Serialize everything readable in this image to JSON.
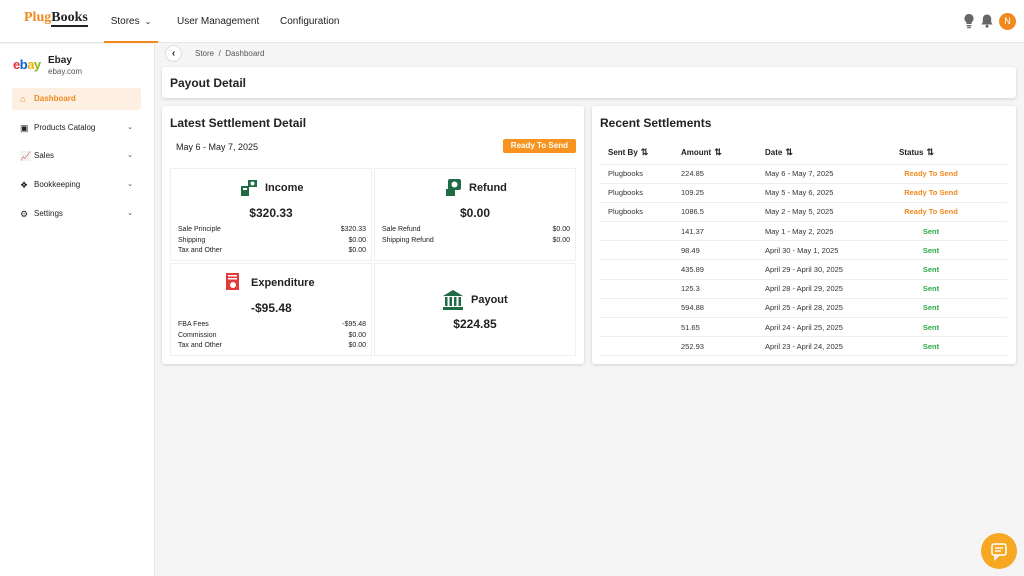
{
  "header": {
    "logo_part1": "Plug",
    "logo_part2": "Books",
    "nav": {
      "stores": "Stores",
      "user_management": "User Management",
      "configuration": "Configuration"
    },
    "avatar_initial": "N",
    "icons": [
      "lightbulb-icon",
      "bell-icon"
    ]
  },
  "sidebar": {
    "store_logo": {
      "e": "e",
      "b": "b",
      "a": "a",
      "y": "y"
    },
    "store_name": "Ebay",
    "store_domain": "ebay.com",
    "items": [
      {
        "label": "Dashboard",
        "icon": "home-icon",
        "active": true
      },
      {
        "label": "Products Catalog",
        "icon": "box-icon"
      },
      {
        "label": "Sales",
        "icon": "chart-icon"
      },
      {
        "label": "Bookkeeping",
        "icon": "book-icon"
      },
      {
        "label": "Settings",
        "icon": "gear-icon"
      }
    ]
  },
  "breadcrumb": {
    "store": "Store",
    "sep": "/",
    "page": "Dashboard"
  },
  "page_title": "Payout Detail",
  "latest": {
    "title": "Latest Settlement Detail",
    "range": "May 6 - May 7, 2025",
    "badge": "Ready To Send",
    "income": {
      "title": "Income",
      "amount": "$320.33",
      "rows": [
        {
          "label": "Sale Principle",
          "value": "$320.33"
        },
        {
          "label": "Shipping",
          "value": "$0.00"
        },
        {
          "label": "Tax and Other",
          "value": "$0.00"
        }
      ]
    },
    "refund": {
      "title": "Refund",
      "amount": "$0.00",
      "rows": [
        {
          "label": "Sale Refund",
          "value": "$0.00"
        },
        {
          "label": "Shipping Refund",
          "value": "$0.00"
        }
      ]
    },
    "expenditure": {
      "title": "Expenditure",
      "amount": "-$95.48",
      "rows": [
        {
          "label": "FBA Fees",
          "value": "-$95.48"
        },
        {
          "label": "Commission",
          "value": "$0.00"
        },
        {
          "label": "Tax and Other",
          "value": "$0.00"
        }
      ]
    },
    "payout": {
      "title": "Payout",
      "amount": "$224.85"
    }
  },
  "recent": {
    "title": "Recent Settlements",
    "columns": [
      "Sent By",
      "Amount",
      "Date",
      "Status"
    ],
    "rows": [
      {
        "sent_by": "Plugbooks",
        "amount": "224.85",
        "date": "May 6 - May 7, 2025",
        "status": "Ready To Send"
      },
      {
        "sent_by": "Plugbooks",
        "amount": "109.25",
        "date": "May 5 - May 6, 2025",
        "status": "Ready To Send"
      },
      {
        "sent_by": "Plugbooks",
        "amount": "1086.5",
        "date": "May 2 - May 5, 2025",
        "status": "Ready To Send"
      },
      {
        "sent_by": "",
        "amount": "141.37",
        "date": "May 1 - May 2, 2025",
        "status": "Sent"
      },
      {
        "sent_by": "",
        "amount": "98.49",
        "date": "April 30 - May 1, 2025",
        "status": "Sent"
      },
      {
        "sent_by": "",
        "amount": "435.89",
        "date": "April 29 - April 30, 2025",
        "status": "Sent"
      },
      {
        "sent_by": "",
        "amount": "125.3",
        "date": "April 28 - April 29, 2025",
        "status": "Sent"
      },
      {
        "sent_by": "",
        "amount": "594.88",
        "date": "April 25 - April 28, 2025",
        "status": "Sent"
      },
      {
        "sent_by": "",
        "amount": "51.65",
        "date": "April 24 - April 25, 2025",
        "status": "Sent"
      },
      {
        "sent_by": "",
        "amount": "252.93",
        "date": "April 23 - April 24, 2025",
        "status": "Sent"
      }
    ]
  },
  "colors": {
    "accent": "#f08a1e",
    "sent": "#2ea84a",
    "icon_green": "#1f6b45",
    "icon_red": "#e23b3b"
  }
}
